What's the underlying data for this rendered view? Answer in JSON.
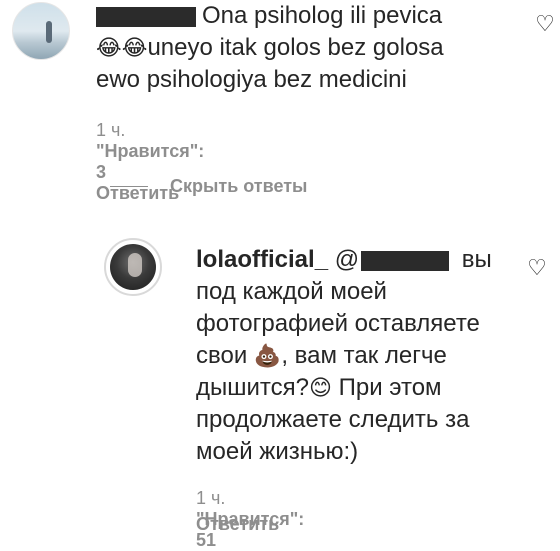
{
  "comment1": {
    "text_line1": "Ona psiholog ili pevica",
    "emoji1": "😂",
    "emoji2": "😂",
    "text_line2": "uneyo itak golos bez golosa",
    "text_line3": "ewo psihologiya bez medicini",
    "time": "1 ч.",
    "likes": "\"Нравится\": 3",
    "reply": "Ответить"
  },
  "hide_replies": "Скрыть ответы",
  "comment2": {
    "username": "lolaofficial_",
    "mention_prefix": "@",
    "text_after_mention": "вы",
    "line2": "под каждой моей",
    "line3": "фотографией оставляете",
    "line4a": "свои",
    "emoji_poop": "💩",
    "line4b": ", вам так легче",
    "line5a": "дышится?",
    "emoji_smile": "😊",
    "line5b": "При этом",
    "line6": "продолжаете следить за",
    "line7": "моей жизнью:)",
    "time": "1 ч.",
    "likes": "\"Нравится\": 51",
    "reply": "Ответить"
  },
  "icons": {
    "heart": "heart-outline-icon"
  }
}
